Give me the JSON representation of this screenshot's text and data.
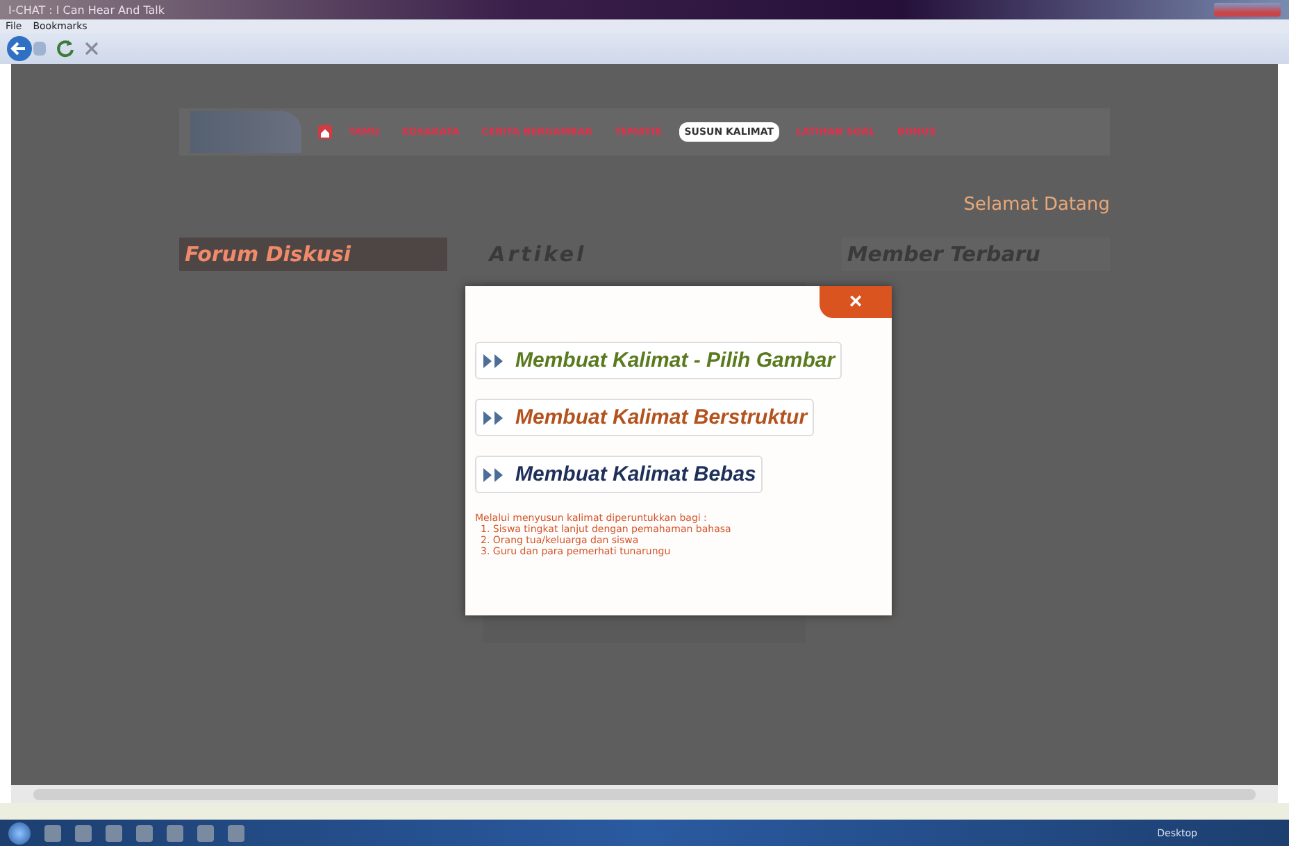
{
  "window": {
    "title": "I-CHAT : I Can Hear And Talk"
  },
  "menu": [
    "File",
    "Bookmarks"
  ],
  "nav": [
    {
      "label": "TAMU",
      "selected": false
    },
    {
      "label": "KOSAKATA",
      "selected": false
    },
    {
      "label": "CERITA BERGAMBAR",
      "selected": false
    },
    {
      "label": "TEMATIK",
      "selected": false
    },
    {
      "label": "SUSUN KALIMAT",
      "selected": true
    },
    {
      "label": "LATIHAN SOAL",
      "selected": false
    },
    {
      "label": "BONUS",
      "selected": false
    }
  ],
  "welcome": "Selamat Datang",
  "forum": {
    "title": "Forum Diskusi"
  },
  "article": {
    "title": "Artikel"
  },
  "members": {
    "title": "Member Terbaru"
  },
  "modal": {
    "close": "×",
    "options": [
      {
        "label": "Membuat Kalimat - Pilih  Gambar",
        "color": "#5a7a1e"
      },
      {
        "label": "Membuat Kalimat Berstruktur",
        "color": "#b4521e"
      },
      {
        "label": "Membuat Kalimat Bebas",
        "color": "#1e2f5a"
      }
    ],
    "note": "Melalui menyusun kalimat diperuntukkan bagi :",
    "audience": [
      "1.  Siswa tingkat lanjut dengan pemahaman bahasa",
      "2.  Orang tua/keluarga dan siswa",
      "3.  Guru dan para pemerhati tunarungu"
    ]
  },
  "taskbar": {
    "desktop": "Desktop"
  }
}
